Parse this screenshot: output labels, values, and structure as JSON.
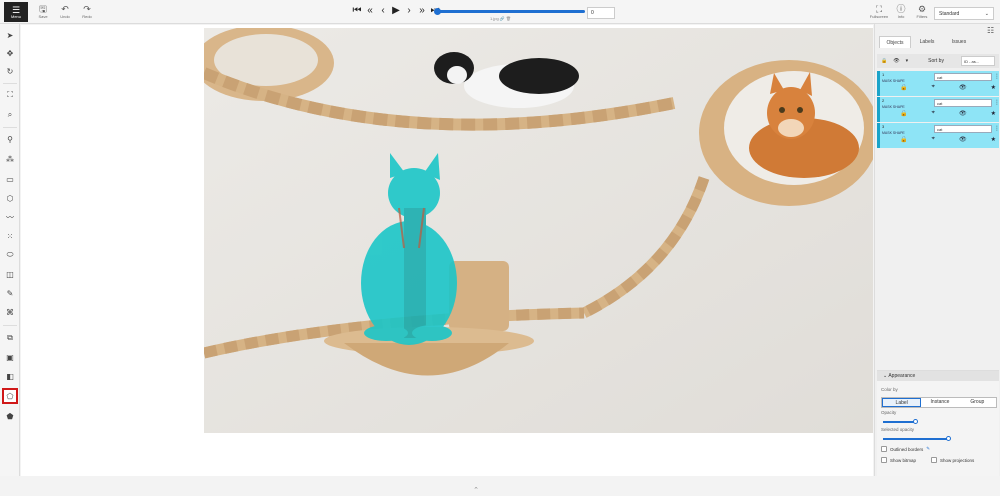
{
  "toolbar": {
    "menu_label": "Menu",
    "save_label": "Save",
    "undo_label": "Undo",
    "redo_label": "Redo",
    "frame_value": "0",
    "filename": "1.jpg",
    "fullscreen_label": "Fullscreen",
    "info_label": "Info",
    "filters_label": "Filters",
    "workspace": "Standard"
  },
  "player_controls": [
    "first",
    "prev-step",
    "prev",
    "play",
    "next",
    "next-step",
    "last"
  ],
  "right_panel": {
    "tabs": [
      {
        "label": "Objects",
        "active": true
      },
      {
        "label": "Labels",
        "active": false
      },
      {
        "label": "Issues",
        "active": false
      }
    ],
    "sort_label": "Sort by",
    "sort_value": "ID - as...",
    "objects": [
      {
        "id": "1",
        "type": "MASK SHAPE",
        "label": "cat"
      },
      {
        "id": "2",
        "type": "MASK SHAPE",
        "label": "cat"
      },
      {
        "id": "3",
        "type": "MASK SHAPE",
        "label": "cat"
      }
    ],
    "appearance": {
      "title": "Appearance",
      "color_by_label": "Color by",
      "color_by_options": [
        "Label",
        "Instance",
        "Group"
      ],
      "color_by_selected": "Label",
      "opacity_label": "Opacity",
      "opacity": 0.3,
      "selected_opacity_label": "Selected opacity",
      "selected_opacity": 0.6,
      "outlined_borders_label": "Outlined borders",
      "show_bitmap_label": "Show bitmap",
      "show_projections_label": "Show projections"
    }
  },
  "colors": {
    "accent": "#1f6fd1",
    "object_highlight": "#8ee4f6",
    "mask_overlay": "#1cc6c8",
    "active_tool_border": "#d01818"
  }
}
